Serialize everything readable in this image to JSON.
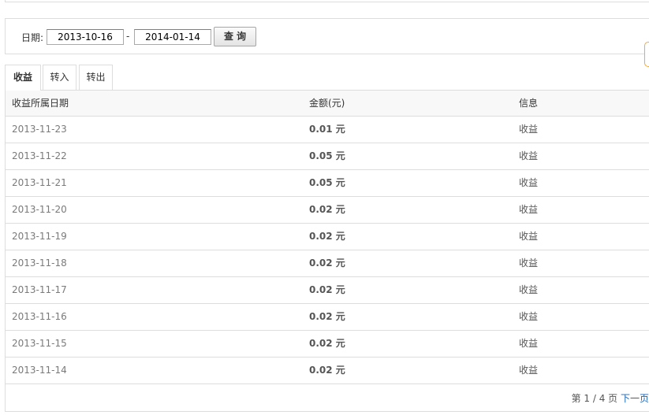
{
  "filter": {
    "date_label": "日期:",
    "start_date": "2013-10-16",
    "separator": "-",
    "end_date": "2014-01-14",
    "query_button": "查询"
  },
  "tabs": [
    {
      "label": "收益",
      "active": true
    },
    {
      "label": "转入",
      "active": false
    },
    {
      "label": "转出",
      "active": false
    }
  ],
  "table": {
    "headers": [
      "收益所属日期",
      "金额(元)",
      "信息"
    ],
    "rows": [
      {
        "date": "2013-11-23",
        "amount": "0.01 元",
        "info": "收益"
      },
      {
        "date": "2013-11-22",
        "amount": "0.05 元",
        "info": "收益"
      },
      {
        "date": "2013-11-21",
        "amount": "0.05 元",
        "info": "收益"
      },
      {
        "date": "2013-11-20",
        "amount": "0.02 元",
        "info": "收益"
      },
      {
        "date": "2013-11-19",
        "amount": "0.02 元",
        "info": "收益"
      },
      {
        "date": "2013-11-18",
        "amount": "0.02 元",
        "info": "收益"
      },
      {
        "date": "2013-11-17",
        "amount": "0.02 元",
        "info": "收益"
      },
      {
        "date": "2013-11-16",
        "amount": "0.02 元",
        "info": "收益"
      },
      {
        "date": "2013-11-15",
        "amount": "0.02 元",
        "info": "收益"
      },
      {
        "date": "2013-11-14",
        "amount": "0.02 元",
        "info": "收益"
      }
    ]
  },
  "pager": {
    "page_text": "第 1 / 4 页",
    "next_label": "下一页"
  },
  "colors": {
    "border": "#dddddd",
    "link": "#1a64b8",
    "accent_orange": "#f0a940"
  }
}
